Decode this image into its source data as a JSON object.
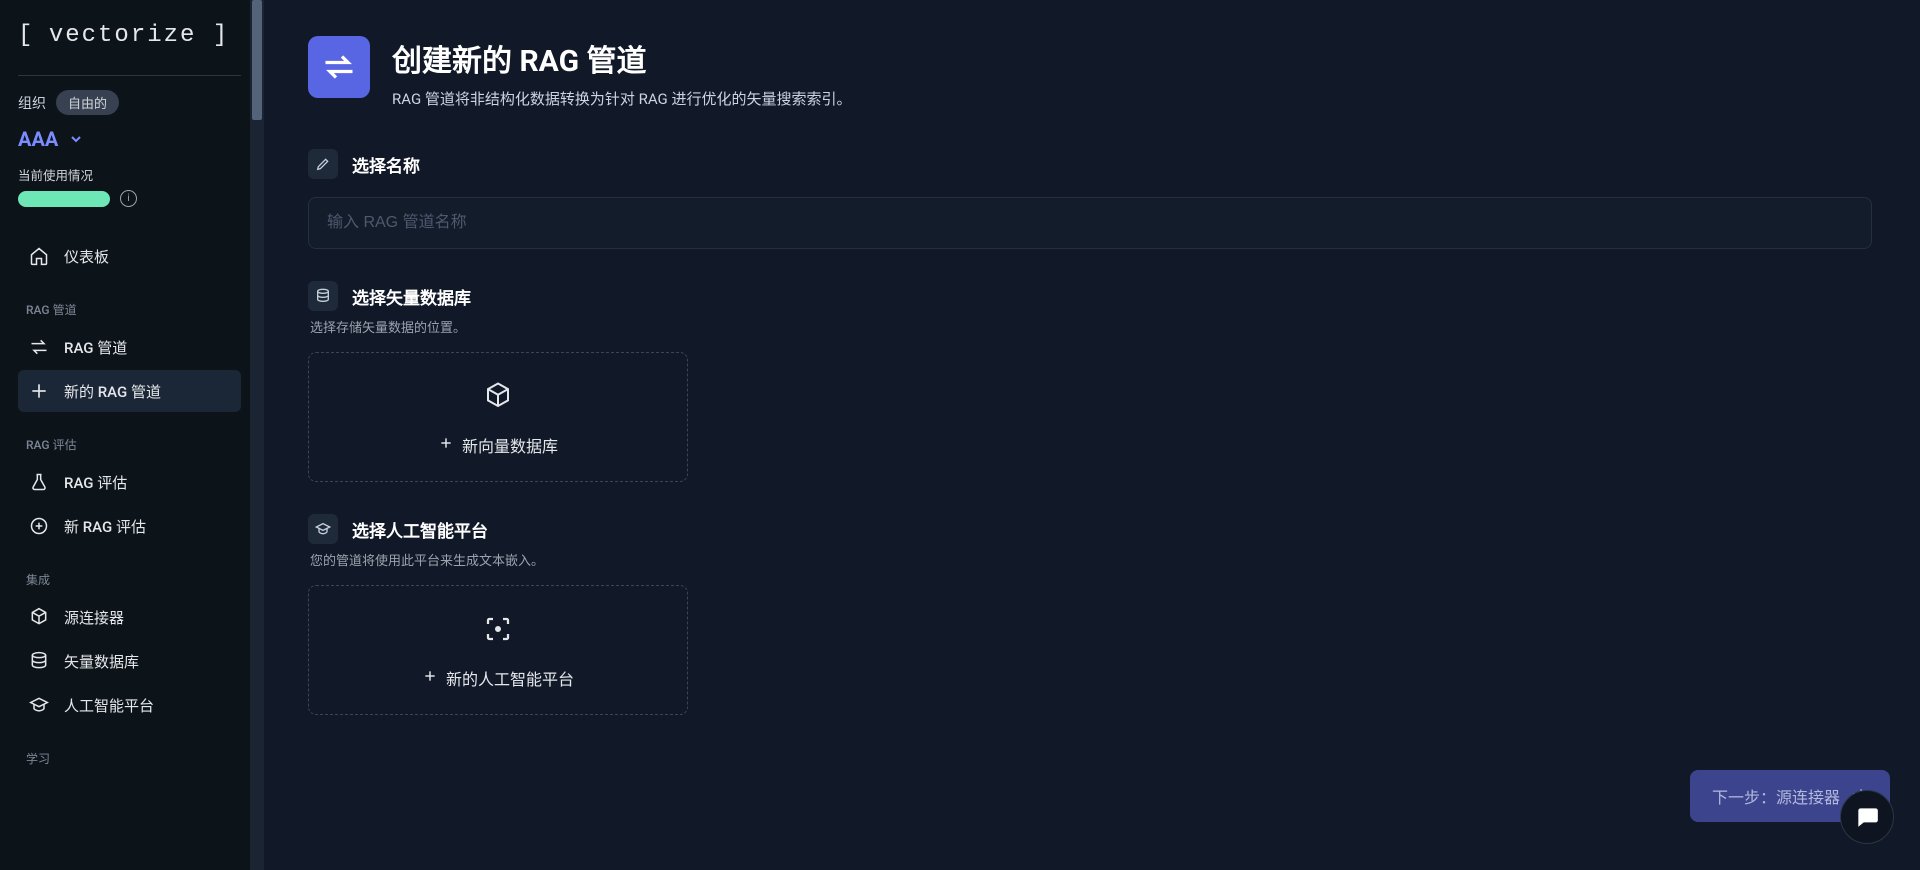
{
  "brand": {
    "name": "vectorize"
  },
  "sidebar": {
    "org_label": "组织",
    "org_badge": "自由的",
    "org_name": "AAA",
    "usage_label": "当前使用情况",
    "dashboard_label": "仪表板",
    "sections": {
      "pipelines": {
        "label": "RAG 管道",
        "items": [
          "RAG 管道",
          "新的 RAG 管道"
        ]
      },
      "eval": {
        "label": "RAG 评估",
        "items": [
          "RAG 评估",
          "新 RAG 评估"
        ]
      },
      "integration": {
        "label": "集成",
        "items": [
          "源连接器",
          "矢量数据库",
          "人工智能平台"
        ]
      },
      "learn": {
        "label": "学习"
      }
    }
  },
  "page": {
    "title": "创建新的 RAG 管道",
    "subtitle": "RAG 管道将非结构化数据转换为针对 RAG 进行优化的矢量搜索索引。"
  },
  "name_section": {
    "title": "选择名称",
    "placeholder": "输入 RAG 管道名称"
  },
  "db_section": {
    "title": "选择矢量数据库",
    "subtitle": "选择存储矢量数据的位置。",
    "add_label": "新向量数据库"
  },
  "ai_section": {
    "title": "选择人工智能平台",
    "subtitle": "您的管道将使用此平台来生成文本嵌入。",
    "add_label": "新的人工智能平台"
  },
  "footer": {
    "next_label": "下一步：源连接器"
  }
}
